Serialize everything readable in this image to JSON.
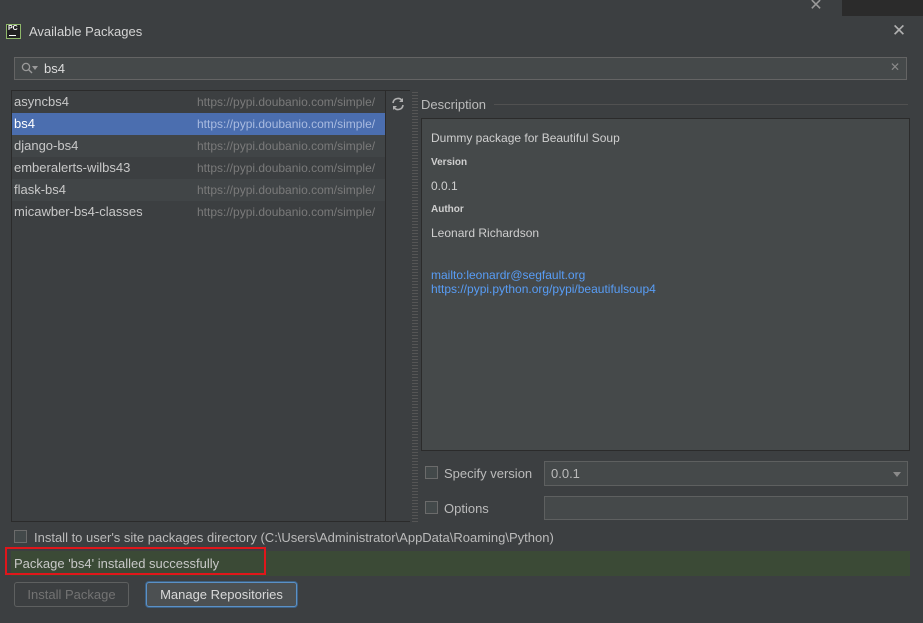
{
  "window": {
    "title": "Available Packages",
    "app_icon_text": "PC"
  },
  "search": {
    "value": "bs4"
  },
  "packages": [
    {
      "name": "asyncbs4",
      "repo": "https://pypi.doubanio.com/simple/"
    },
    {
      "name": "bs4",
      "repo": "https://pypi.doubanio.com/simple/",
      "selected": true
    },
    {
      "name": "django-bs4",
      "repo": "https://pypi.doubanio.com/simple/"
    },
    {
      "name": "emberalerts-wilbs43",
      "repo": "https://pypi.doubanio.com/simple/"
    },
    {
      "name": "flask-bs4",
      "repo": "https://pypi.doubanio.com/simple/"
    },
    {
      "name": "micawber-bs4-classes",
      "repo": "https://pypi.doubanio.com/simple/"
    }
  ],
  "description": {
    "header": "Description",
    "summary": "Dummy package for Beautiful Soup",
    "version_label": "Version",
    "version_value": "0.0.1",
    "author_label": "Author",
    "author_value": "Leonard Richardson",
    "mailto": "mailto:leonardr@segfault.org",
    "url": "https://pypi.python.org/pypi/beautifulsoup4"
  },
  "specify_version": {
    "label": "Specify version",
    "checked": false,
    "value": "0.0.1"
  },
  "options": {
    "label": "Options",
    "checked": false,
    "value": ""
  },
  "install_user_site": {
    "label": "Install to user's site packages directory (C:\\Users\\Administrator\\AppData\\Roaming\\Python)",
    "checked": false
  },
  "status": {
    "message": "Package 'bs4' installed successfully"
  },
  "buttons": {
    "install": "Install Package",
    "manage": "Manage Repositories"
  },
  "colors": {
    "background": "#3c3f41",
    "selection": "#4b6eaf",
    "link": "#589df6",
    "success_bar": "#3b4a36",
    "highlight_box": "#e0161b"
  },
  "icons": {
    "search": "search-icon",
    "refresh": "refresh-icon",
    "close": "close-icon",
    "clear": "clear-search-icon"
  }
}
